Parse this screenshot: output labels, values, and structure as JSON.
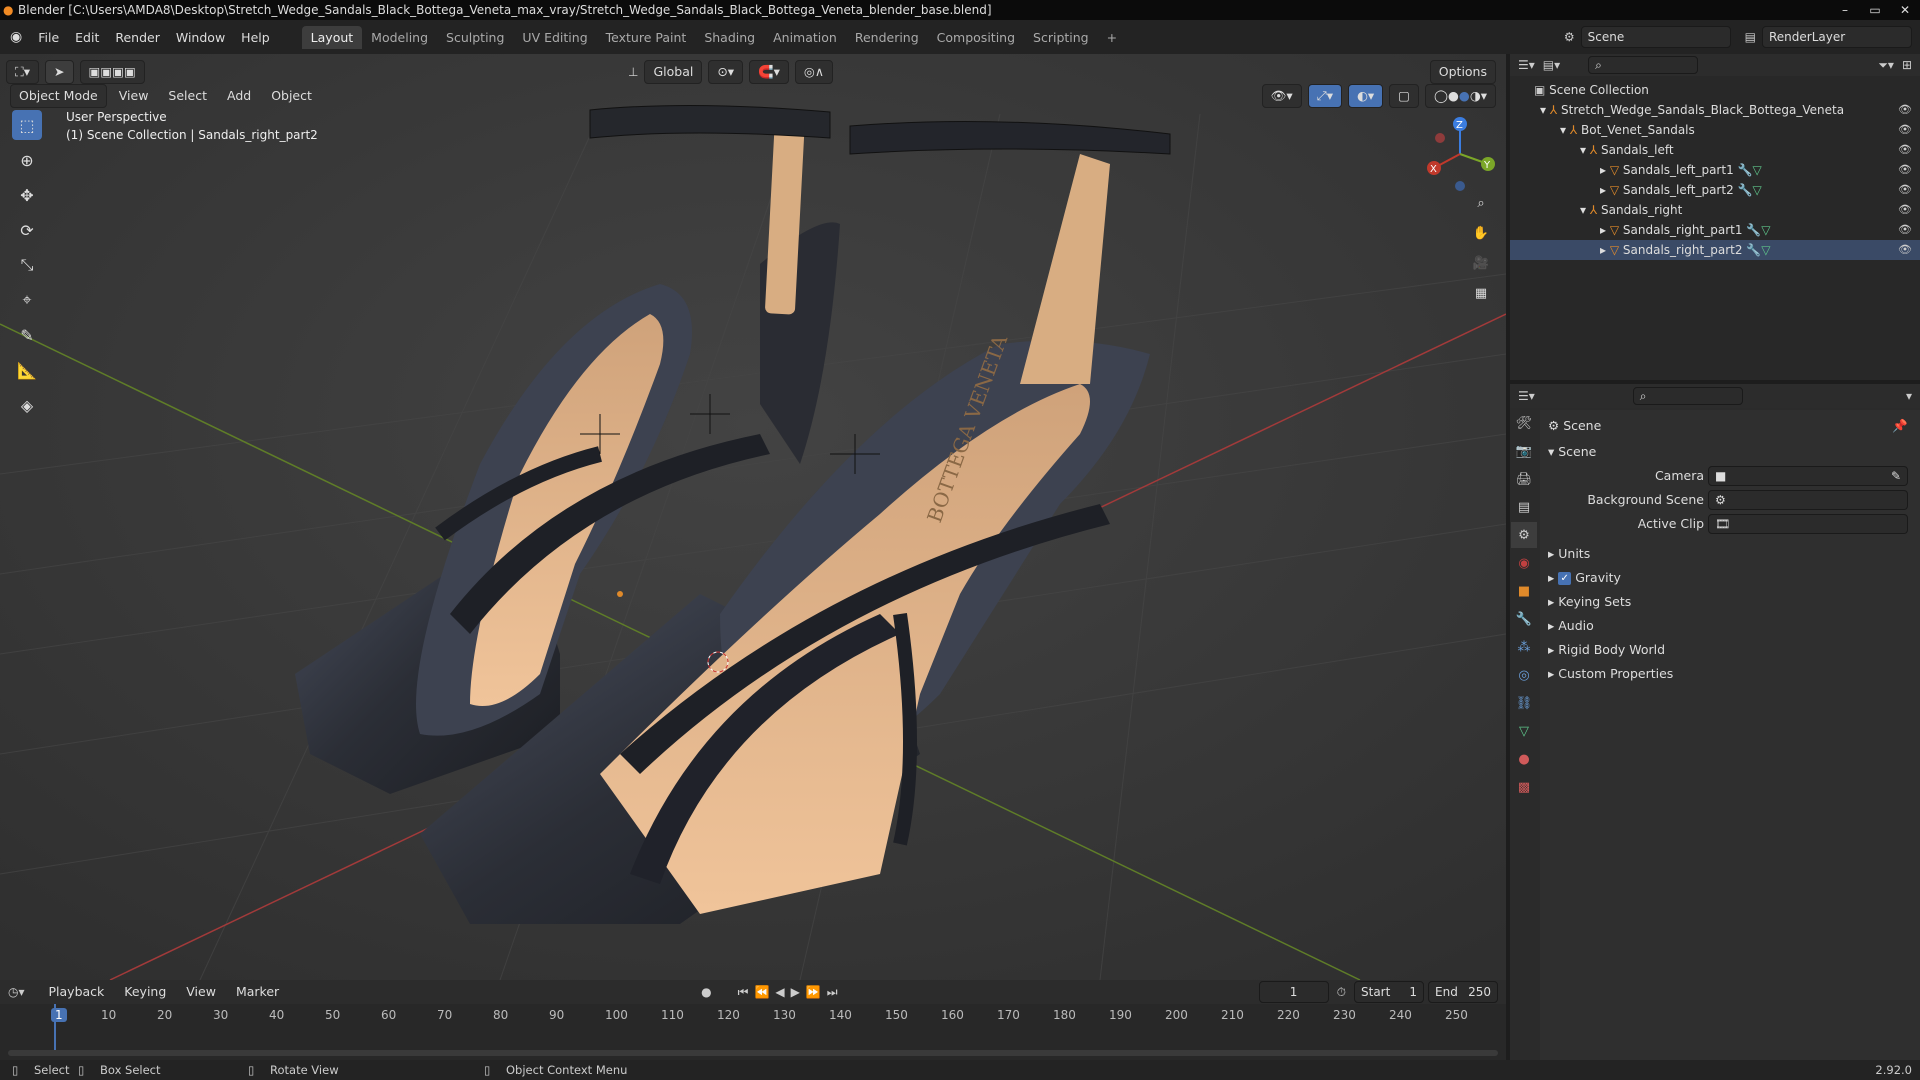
{
  "title": "Blender [C:\\Users\\AMDA8\\Desktop\\Stretch_Wedge_Sandals_Black_Bottega_Veneta_max_vray/Stretch_Wedge_Sandals_Black_Bottega_Veneta_blender_base.blend]",
  "menu": [
    "File",
    "Edit",
    "Render",
    "Window",
    "Help"
  ],
  "workspaces": [
    "Layout",
    "Modeling",
    "Sculpting",
    "UV Editing",
    "Texture Paint",
    "Shading",
    "Animation",
    "Rendering",
    "Compositing",
    "Scripting"
  ],
  "workspace_add": "+",
  "scene_field": "Scene",
  "renderlayer_field": "RenderLayer",
  "toolbar": {
    "orientation": "Global",
    "options": "Options"
  },
  "viewport": {
    "mode": "Object Mode",
    "menus": [
      "View",
      "Select",
      "Add",
      "Object"
    ],
    "perspective": "User Perspective",
    "collection_info": "(1) Scene Collection | Sandals_right_part2",
    "gizmo": {
      "z": "Z",
      "y": "Y",
      "x": "X"
    },
    "brand_text": "BOTTEGA VENETA"
  },
  "outliner": {
    "rows": [
      {
        "label": "Scene Collection",
        "depth": 0
      },
      {
        "label": "Stretch_Wedge_Sandals_Black_Bottega_Veneta",
        "depth": 1
      },
      {
        "label": "Bot_Venet_Sandals",
        "depth": 2
      },
      {
        "label": "Sandals_left",
        "depth": 3
      },
      {
        "label": "Sandals_left_part1",
        "depth": 4
      },
      {
        "label": "Sandals_left_part2",
        "depth": 4
      },
      {
        "label": "Sandals_right",
        "depth": 3
      },
      {
        "label": "Sandals_right_part1",
        "depth": 4
      },
      {
        "label": "Sandals_right_part2",
        "depth": 4
      }
    ]
  },
  "properties": {
    "header": "Scene",
    "section": "Scene",
    "camera_label": "Camera",
    "background_label": "Background Scene",
    "clip_label": "Active Clip",
    "panels": [
      "Units",
      "Gravity",
      "Keying Sets",
      "Audio",
      "Rigid Body World",
      "Custom Properties"
    ],
    "gravity_checked": true
  },
  "timeline": {
    "menus": [
      "Playback",
      "Keying",
      "View",
      "Marker"
    ],
    "current_frame": "1",
    "start_label": "Start",
    "start": "1",
    "end_label": "End",
    "end": "250",
    "ticks": [
      "1",
      "10",
      "20",
      "30",
      "40",
      "50",
      "60",
      "70",
      "80",
      "90",
      "100",
      "110",
      "120",
      "130",
      "140",
      "150",
      "160",
      "170",
      "180",
      "190",
      "200",
      "210",
      "220",
      "230",
      "240",
      "250"
    ]
  },
  "status": {
    "select": "Select",
    "box_select": "Box Select",
    "rotate": "Rotate View",
    "context": "Object Context Menu",
    "version": "2.92.0"
  },
  "colors": {
    "accent": "#4772b3",
    "viewport": "#3a3a3a",
    "x_axis": "#c0392b",
    "y_axis": "#7ba628",
    "leather": "#2a2d35",
    "insole": "#e8b98a"
  }
}
